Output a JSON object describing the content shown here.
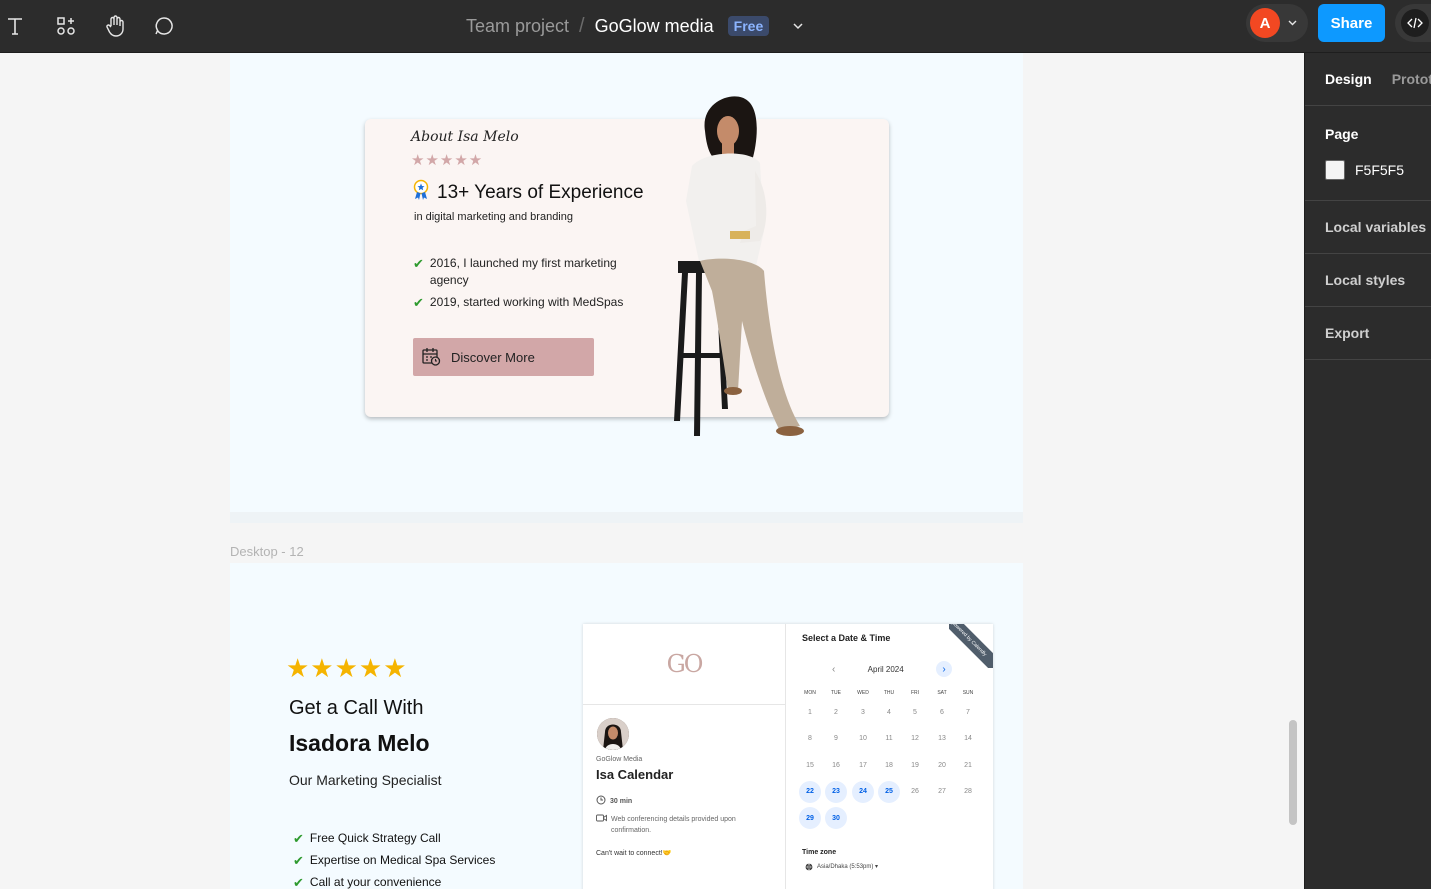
{
  "toolbar": {
    "tools": [
      "text-tool",
      "components-tool",
      "hand-tool",
      "comment-tool"
    ],
    "team": "Team project",
    "separator": "/",
    "file": "GoGlow media",
    "plan": "Free",
    "avatar_initial": "A",
    "share_label": "Share",
    "accent_color": "#0d99ff",
    "avatar_color": "#f24822"
  },
  "right_panel": {
    "tabs": [
      "Design",
      "Prototype"
    ],
    "page_heading": "Page",
    "page_color": "F5F5F5",
    "sections": [
      "Local variables",
      "Local styles",
      "Export"
    ]
  },
  "canvas": {
    "frame_label": "Desktop - 12",
    "about": {
      "title": "About Isa Melo",
      "stars": "★★★★★",
      "heading": "13+ Years of Experience",
      "subheading": "in digital marketing and branding",
      "items": [
        "2016, I launched my first marketing agency",
        "2019, started working with MedSpas"
      ],
      "button": "Discover More"
    },
    "call": {
      "stars": "★★★★★",
      "line1": "Get a Call With",
      "line2": "Isadora Melo",
      "subtitle": "Our Marketing Specialist",
      "items": [
        "Free Quick Strategy Call",
        "Expertise on Medical Spa Services",
        "Call at your convenience"
      ]
    },
    "calendar": {
      "logo": "GO",
      "org": "GoGlow Media",
      "event": "Isa Calendar",
      "duration": "30 min",
      "conf_note": "Web conferencing details provided upon confirmation.",
      "connect_note": "Can't wait to connect!🤝",
      "title": "Select a Date & Time",
      "ribbon": "powered by Calendly",
      "month": "April 2024",
      "weekdays": [
        "MON",
        "TUE",
        "WED",
        "THU",
        "FRI",
        "SAT",
        "SUN"
      ],
      "weeks": [
        [
          "1",
          "2",
          "3",
          "4",
          "5",
          "6",
          "7"
        ],
        [
          "8",
          "9",
          "10",
          "11",
          "12",
          "13",
          "14"
        ],
        [
          "15",
          "16",
          "17",
          "18",
          "19",
          "20",
          "21"
        ],
        [
          "22",
          "23",
          "24",
          "25",
          "26",
          "27",
          "28"
        ],
        [
          "29",
          "30"
        ]
      ],
      "available_days": [
        "22",
        "23",
        "24",
        "25",
        "29",
        "30"
      ],
      "tz_label": "Time zone",
      "tz_value": "Asia/Dhaka (5:53pm) ▾"
    }
  }
}
